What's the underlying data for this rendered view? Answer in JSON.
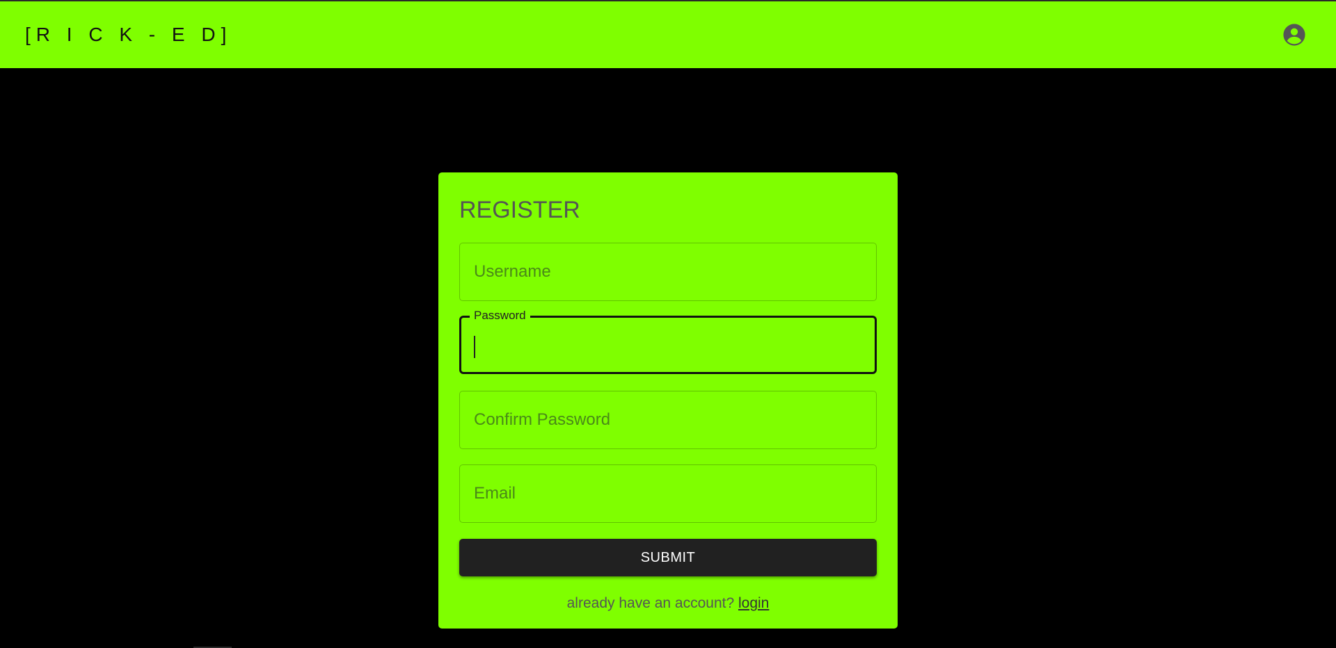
{
  "colors": {
    "accent": "#7fff00",
    "background": "#000000",
    "button": "#212121"
  },
  "header": {
    "brand": "[R I C K - E D]",
    "account_icon": "account-circle-icon"
  },
  "register": {
    "title": "REGISTER",
    "fields": {
      "username": {
        "placeholder": "Username",
        "value": ""
      },
      "password": {
        "label": "Password",
        "value": ""
      },
      "confirm_password": {
        "placeholder": "Confirm Password",
        "value": ""
      },
      "email": {
        "placeholder": "Email",
        "value": ""
      }
    },
    "submit_label": "SUBMIT",
    "footer": {
      "text": "already have an account?",
      "link": "login"
    }
  }
}
